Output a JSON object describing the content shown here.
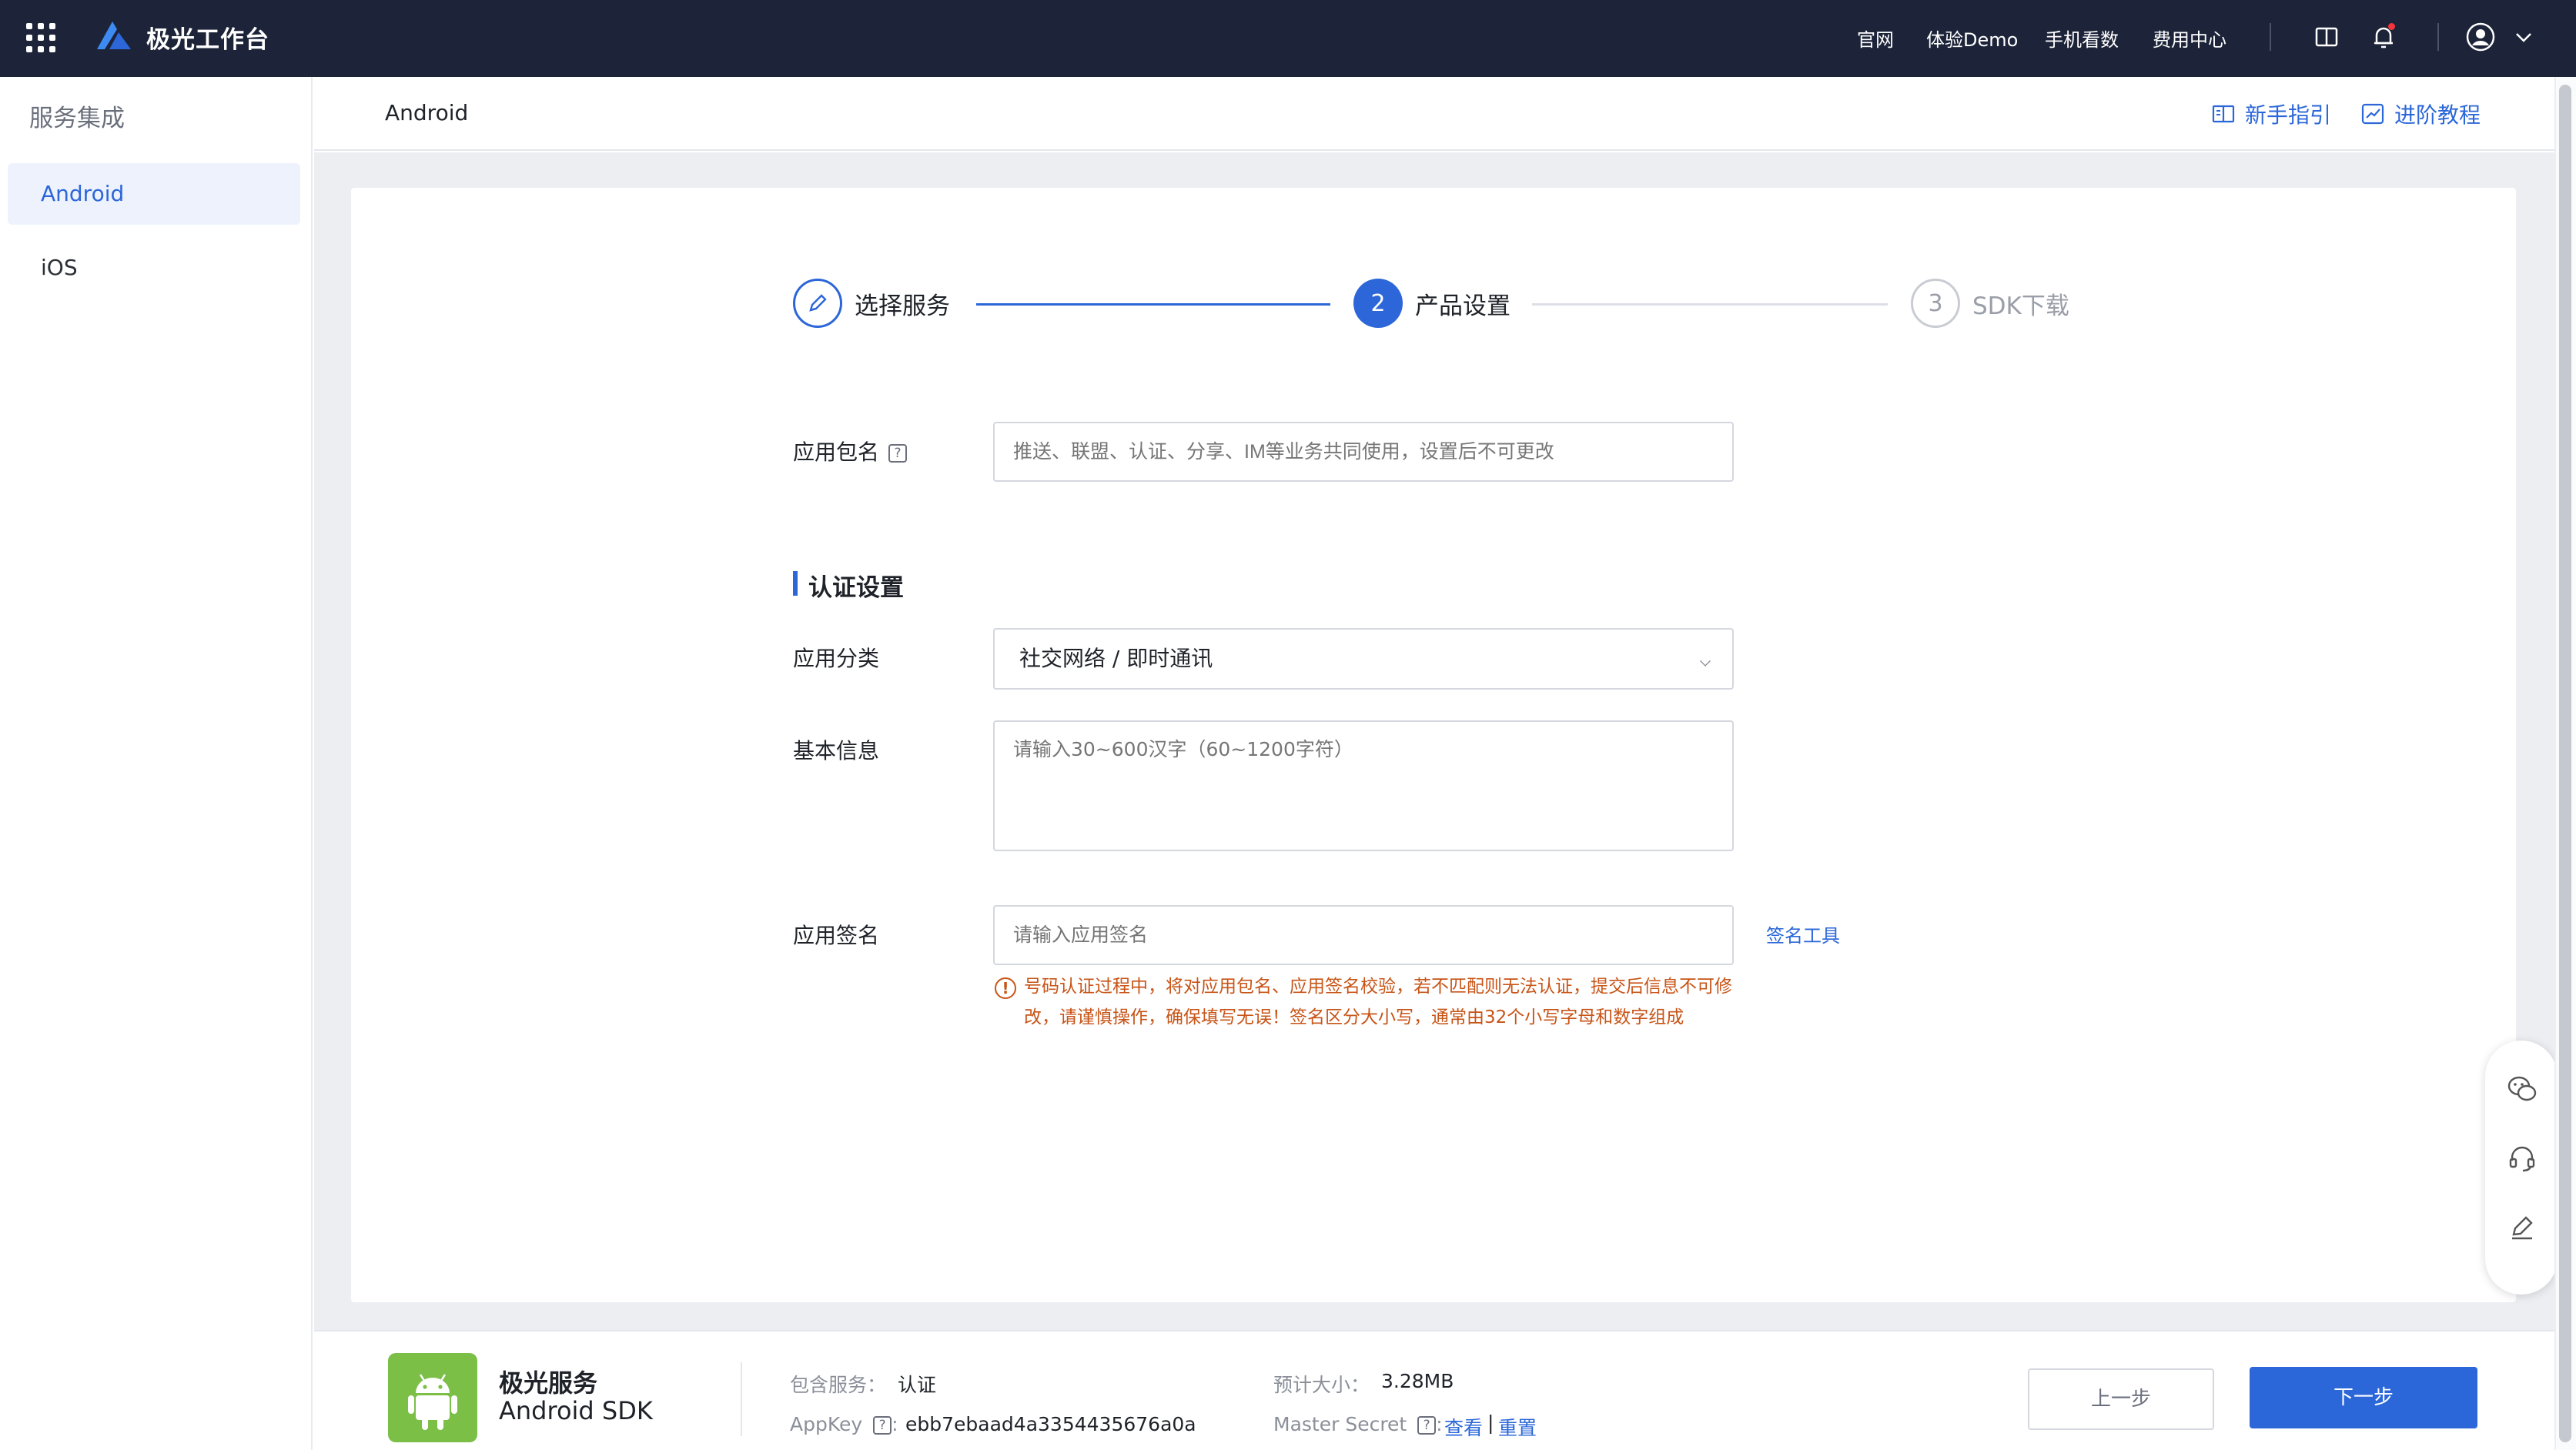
{
  "topbar": {
    "brand": "极光工作台",
    "links": [
      "官网",
      "体验Demo",
      "手机看数",
      "费用中心"
    ],
    "icons": [
      "apps-grid-icon",
      "book-icon",
      "bell-icon",
      "user-avatar-icon",
      "chevron-down-icon"
    ]
  },
  "sidebar": {
    "title": "服务集成",
    "items": [
      {
        "label": "Android",
        "active": true
      },
      {
        "label": "iOS",
        "active": false
      }
    ]
  },
  "subheader": {
    "title": "Android",
    "guide_label": "新手指引",
    "advanced_label": "进阶教程"
  },
  "steps": [
    {
      "label": "选择服务",
      "state": "done"
    },
    {
      "number": "2",
      "label": "产品设置",
      "state": "active"
    },
    {
      "number": "3",
      "label": "SDK下载",
      "state": "todo"
    }
  ],
  "form": {
    "package_name": {
      "label": "应用包名",
      "help": "?",
      "placeholder": "推送、联盟、认证、分享、IM等业务共同使用，设置后不可更改"
    },
    "auth_section_title": "认证设置",
    "category": {
      "label": "应用分类",
      "value": "社交网络 / 即时通讯"
    },
    "basic_info": {
      "label": "基本信息",
      "placeholder": "请输入30~600汉字（60~1200字符）"
    },
    "signature": {
      "label": "应用签名",
      "placeholder": "请输入应用签名",
      "tool_link": "签名工具",
      "warning_icon": "!",
      "warning": "号码认证过程中，将对应用包名、应用签名校验，若不匹配则无法认证，提交后信息不可修改，请谨慎操作，确保填写无误！签名区分大小写，通常由32个小写字母和数字组成"
    }
  },
  "float_panel": {
    "icons": [
      "wechat-icon",
      "headset-icon",
      "edit-icon"
    ]
  },
  "bottom": {
    "sdk_title": "极光服务",
    "sdk_subtitle": "Android SDK",
    "services_label": "包含服务：",
    "services_value": "认证",
    "size_label": "预计大小：",
    "size_value": "3.28MB",
    "appkey_label": "AppKey",
    "appkey_help": "?",
    "appkey_colon": ":",
    "appkey_value": "ebb7ebaad4a3354435676a0a",
    "master_secret_label": "Master Secret",
    "master_secret_help": "?",
    "master_secret_colon": ":",
    "view_link": "查看",
    "separator": "|",
    "reset_link": "重置",
    "prev_button": "上一步",
    "next_button": "下一步"
  },
  "colors": {
    "topbar_bg": "#1d2439",
    "accent": "#2c66d8",
    "warning": "#c85417",
    "android_green": "#7bbf47"
  }
}
